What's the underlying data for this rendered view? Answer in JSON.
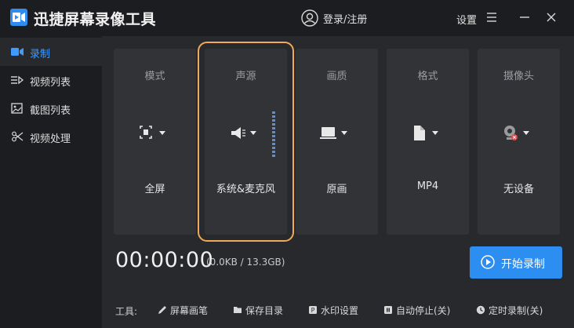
{
  "app": {
    "title": "迅捷屏幕录像工具"
  },
  "header": {
    "login_label": "登录/注册",
    "settings_label": "设置"
  },
  "sidebar": {
    "items": [
      {
        "label": "录制",
        "icon": "video-camera-icon",
        "active": true
      },
      {
        "label": "视频列表",
        "icon": "video-list-icon",
        "active": false
      },
      {
        "label": "截图列表",
        "icon": "screenshot-list-icon",
        "active": false
      },
      {
        "label": "视频处理",
        "icon": "video-process-icon",
        "active": false
      }
    ]
  },
  "cards": [
    {
      "title": "模式",
      "value": "全屏",
      "icon": "fullscreen-icon"
    },
    {
      "title": "声源",
      "value": "系统&麦克风",
      "icon": "speaker-icon",
      "selected": true
    },
    {
      "title": "画质",
      "value": "原画",
      "icon": "monitor-icon"
    },
    {
      "title": "格式",
      "value": "MP4",
      "icon": "file-icon"
    },
    {
      "title": "摄像头",
      "value": "无设备",
      "icon": "webcam-icon"
    }
  ],
  "status": {
    "timer": "00:00:00",
    "filesize": "(0.0KB / 13.3GB)"
  },
  "start_button": {
    "label": "开始录制"
  },
  "toolbar": {
    "label": "工具:",
    "items": [
      {
        "label": "屏幕画笔",
        "icon": "pen-icon"
      },
      {
        "label": "保存目录",
        "icon": "folder-icon"
      },
      {
        "label": "水印设置",
        "icon": "watermark-icon"
      },
      {
        "label": "自动停止(关)",
        "icon": "auto-stop-icon"
      },
      {
        "label": "定时录制(关)",
        "icon": "clock-icon"
      }
    ]
  },
  "colors": {
    "accent": "#2d8ef2",
    "active_text": "#3f9cff",
    "selection_outline": "#f0a95a",
    "background": "#1c1d20",
    "panel": "#27292d",
    "card": "#313337"
  }
}
